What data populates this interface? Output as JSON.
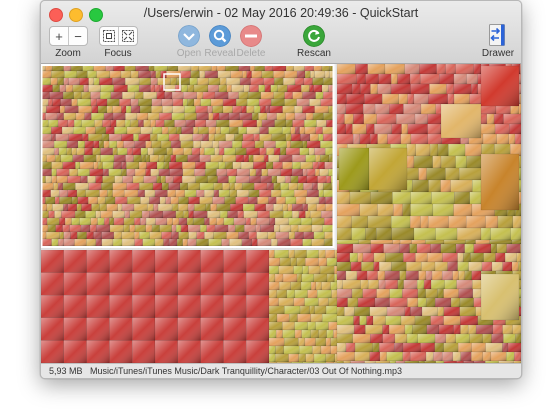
{
  "window": {
    "title": "/Users/erwin - 02 May 2016 20:49:36 - QuickStart"
  },
  "toolbar": {
    "zoom_label": "Zoom",
    "zoom_in_glyph": "+",
    "zoom_out_glyph": "−",
    "focus_label": "Focus",
    "open_label": "Open",
    "reveal_label": "Reveal",
    "delete_label": "Delete",
    "rescan_label": "Rescan",
    "drawer_label": "Drawer",
    "icons": {
      "focus_in": "focus-in-icon",
      "focus_out": "focus-out-icon",
      "open": "open-icon",
      "reveal": "reveal-magnifier-icon",
      "delete": "delete-minus-icon",
      "rescan": "rescan-icon",
      "drawer": "drawer-icon"
    },
    "colors": {
      "rescan": "#3aa63a",
      "open": "#8fb7de",
      "reveal": "#5c9bd8",
      "delete": "#e88a8a"
    }
  },
  "treemap": {
    "palette": [
      "#c33a38",
      "#d8655a",
      "#e4a25e",
      "#d8b05a",
      "#b8a03c",
      "#9a8a2a",
      "#c4c050",
      "#d58a7a",
      "#b05050",
      "#e0c080"
    ]
  },
  "status": {
    "size": "5,93 MB",
    "path": "Music/iTunes/iTunes Music/Dark Tranquillity/Character/03 Out Of Nothing.mp3"
  }
}
